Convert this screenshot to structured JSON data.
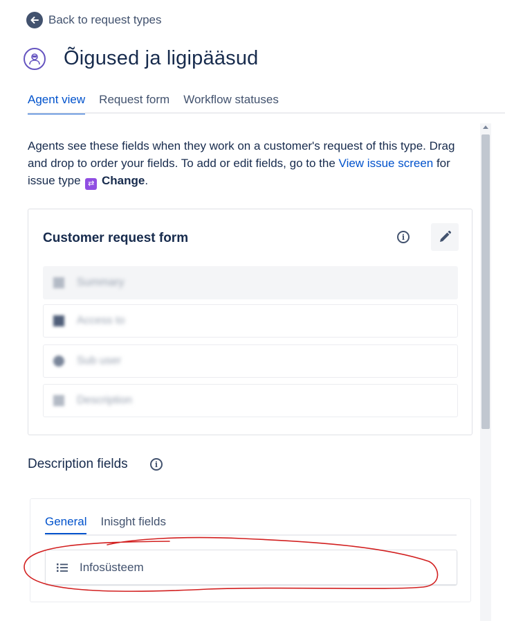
{
  "back_link": {
    "label": "Back to request types"
  },
  "header": {
    "title": "Õigused ja ligipääsud"
  },
  "tabs": [
    {
      "label": "Agent view",
      "active": true
    },
    {
      "label": "Request form",
      "active": false
    },
    {
      "label": "Workflow statuses",
      "active": false
    }
  ],
  "intro": {
    "text_before_link": "Agents see these fields when they work on a customer's request of this type. Drag and drop to order your fields. To add or edit fields, go to the ",
    "link": "View issue screen",
    "text_after_link": " for issue type ",
    "issue_type": "Change",
    "period": "."
  },
  "customer_form": {
    "title": "Customer request form",
    "fields": [
      {
        "label": "Summary",
        "icon": "text-icon"
      },
      {
        "label": "Access to",
        "icon": "select-icon"
      },
      {
        "label": "Sub user",
        "icon": "user-icon"
      },
      {
        "label": "Description",
        "icon": "paragraph-icon"
      }
    ]
  },
  "description_section": {
    "title": "Description fields",
    "tabs": [
      {
        "label": "General",
        "active": true
      },
      {
        "label": "Inisght fields",
        "active": false
      }
    ],
    "fields": [
      {
        "label": "Infosüsteem",
        "icon": "list-icon"
      }
    ]
  },
  "colors": {
    "accent": "#0052cc",
    "text": "#172b4d",
    "annotation": "#d21f1f",
    "change_badge": "#904ee2"
  }
}
